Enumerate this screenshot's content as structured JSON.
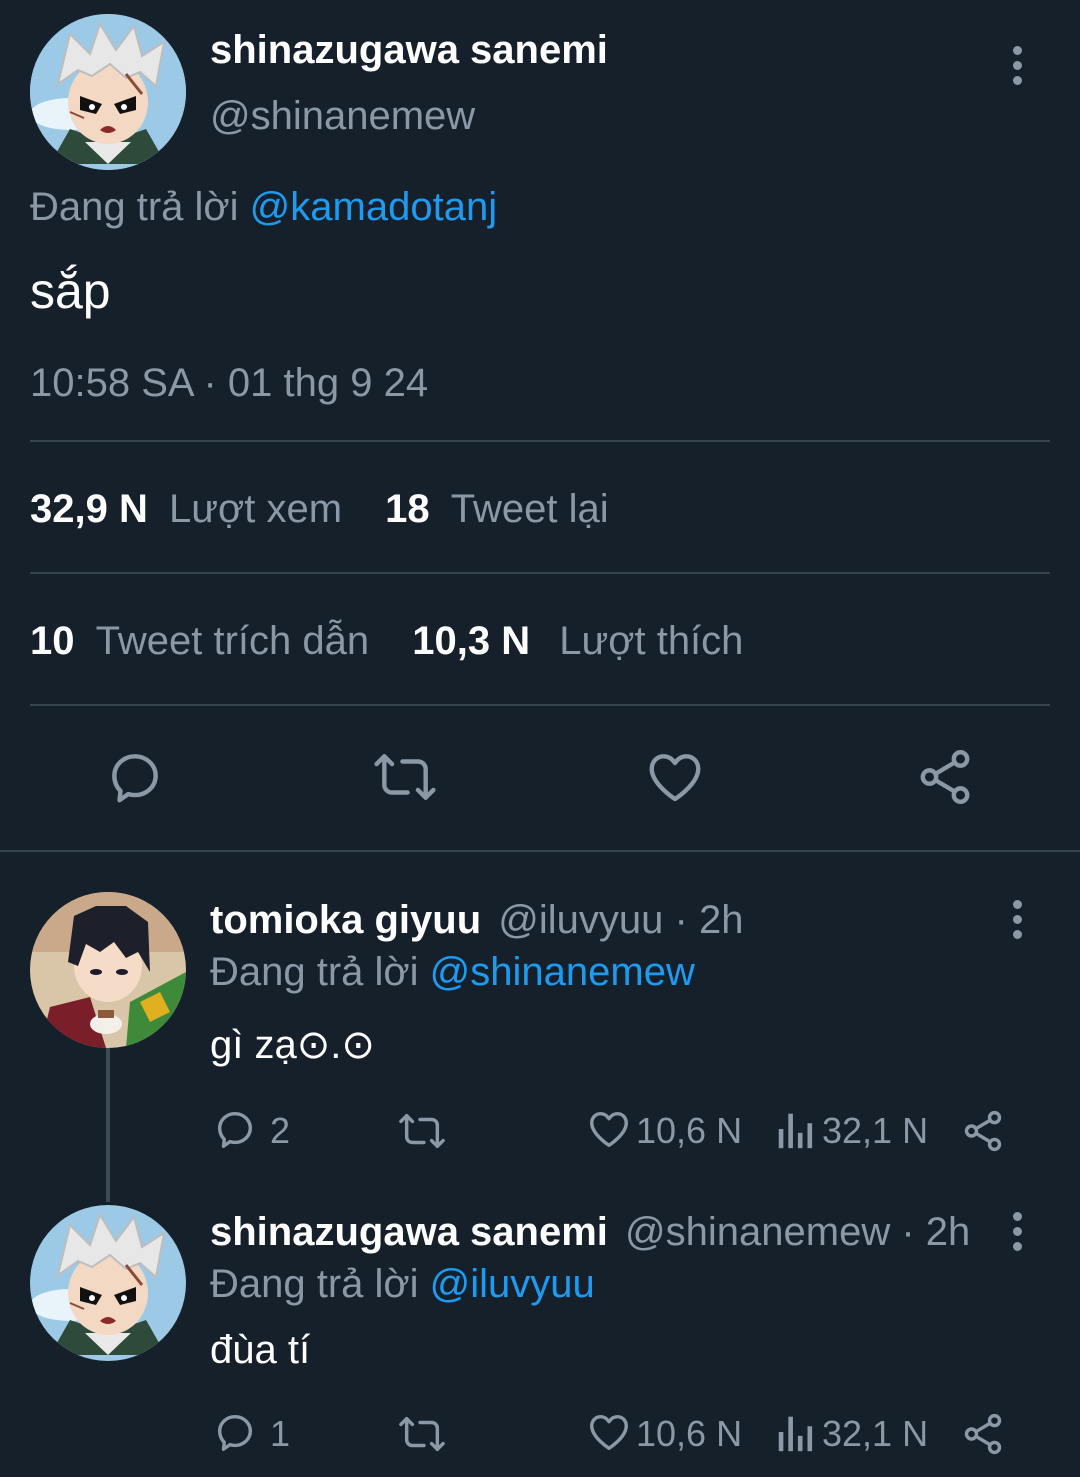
{
  "main_tweet": {
    "display_name": "shinazugawa sanemi",
    "handle": "@shinanemew",
    "replying_prefix": "Đang trả lời",
    "replying_to": "@kamadotanj",
    "text": "sắp",
    "timestamp": "10:58 SA · 01 thg 9 24",
    "stats": {
      "views_value": "32,9 N",
      "views_label": "Lượt xem",
      "retweets_value": "18",
      "retweets_label": "Tweet lại",
      "quotes_value": "10",
      "quotes_label": "Tweet trích dẫn",
      "likes_value": "10,3 N",
      "likes_label": "Lượt thích"
    }
  },
  "replies": [
    {
      "display_name": "tomioka giyuu",
      "handle": "@iluvyuu",
      "time": "· 2h",
      "replying_prefix": "Đang trả lời",
      "replying_to": "@shinanemew",
      "text": "gì zạ⊙.⊙",
      "reply_count": "2",
      "like_count": "10,6 N",
      "view_count": "32,1 N"
    },
    {
      "display_name": "shinazugawa sanemi",
      "handle": "@shinanemew",
      "time": "· 2h",
      "replying_prefix": "Đang trả lời",
      "replying_to": "@iluvyuu",
      "text": "đùa tí",
      "reply_count": "1",
      "like_count": "10,6 N",
      "view_count": "32,1 N"
    }
  ],
  "colors": {
    "background": "#15202b",
    "muted": "#8b98a5",
    "link": "#1d9bf0",
    "divider": "#38444d"
  }
}
